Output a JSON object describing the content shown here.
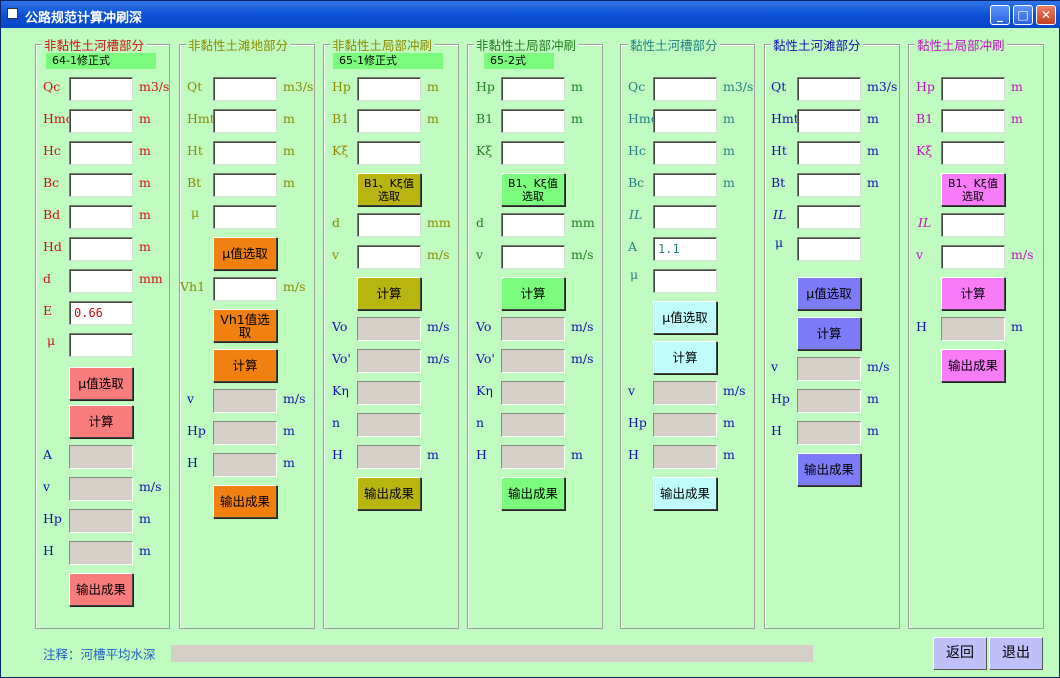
{
  "window": {
    "title": "公路规范计算冲刷深"
  },
  "titlebar_buttons": {
    "minimize": "_",
    "maximize": "□",
    "close": "✕"
  },
  "panels": {
    "p1": {
      "title": "非黏性土河槽部分",
      "tag": "64-1修正式",
      "rows": [
        {
          "label": "Qc",
          "unit": "m3/s",
          "value": ""
        },
        {
          "label": "Hmc",
          "unit": "m",
          "value": ""
        },
        {
          "label": "Hc",
          "unit": "m",
          "value": ""
        },
        {
          "label": "Bc",
          "unit": "m",
          "value": ""
        },
        {
          "label": "Bd",
          "unit": "m",
          "value": ""
        },
        {
          "label": "Hd",
          "unit": "m",
          "value": ""
        },
        {
          "label": "d",
          "unit": "mm",
          "value": ""
        },
        {
          "label": "E",
          "unit": "",
          "value": "0.66"
        },
        {
          "label": "μ",
          "unit": "",
          "value": ""
        }
      ],
      "btn_mu": "μ值选取",
      "btn_calc": "计算",
      "outputs": [
        {
          "label": "A",
          "unit": ""
        },
        {
          "label": "v",
          "unit": "m/s"
        },
        {
          "label": "Hp",
          "unit": "m"
        },
        {
          "label": "H",
          "unit": "m"
        }
      ],
      "btn_out": "输出成果"
    },
    "p2": {
      "title": "非黏性土滩地部分",
      "rows": [
        {
          "label": "Qt",
          "unit": "m3/s"
        },
        {
          "label": "Hmt",
          "unit": "m"
        },
        {
          "label": "Ht",
          "unit": "m"
        },
        {
          "label": "Bt",
          "unit": "m"
        },
        {
          "label": "μ",
          "unit": ""
        }
      ],
      "btn_mu": "μ值选取",
      "vh1_label": "Vh1",
      "vh1_unit": "m/s",
      "btn_vh1": "Vh1值选取",
      "btn_calc": "计算",
      "outputs": [
        {
          "label": "v",
          "unit": "m/s"
        },
        {
          "label": "Hp",
          "unit": "m"
        },
        {
          "label": "H",
          "unit": "m"
        }
      ],
      "btn_out": "输出成果"
    },
    "p3": {
      "title": "非黏性土局部冲刷",
      "tag": "65-1修正式",
      "rows": [
        {
          "label": "Hp",
          "unit": "m"
        },
        {
          "label": "B1",
          "unit": "m"
        },
        {
          "label": "Kξ",
          "unit": ""
        }
      ],
      "btn_b1": "B1、Kξ值选取",
      "rows2": [
        {
          "label": "d",
          "unit": "mm"
        },
        {
          "label": "v",
          "unit": "m/s"
        }
      ],
      "btn_calc": "计算",
      "outputs": [
        {
          "label": "Vo",
          "unit": "m/s"
        },
        {
          "label": "Vo'",
          "unit": "m/s"
        },
        {
          "label": "Kη",
          "unit": ""
        },
        {
          "label": "n",
          "unit": ""
        },
        {
          "label": "H",
          "unit": "m"
        }
      ],
      "btn_out": "输出成果"
    },
    "p4": {
      "title": "非黏性土局部冲刷",
      "tag": "65-2式",
      "rows": [
        {
          "label": "Hp",
          "unit": "m"
        },
        {
          "label": "B1",
          "unit": "m"
        },
        {
          "label": "Kξ",
          "unit": ""
        }
      ],
      "btn_b1": "B1、Kξ值选取",
      "rows2": [
        {
          "label": "d",
          "unit": "mm"
        },
        {
          "label": "v",
          "unit": "m/s"
        }
      ],
      "btn_calc": "计算",
      "outputs": [
        {
          "label": "Vo",
          "unit": "m/s"
        },
        {
          "label": "Vo'",
          "unit": "m/s"
        },
        {
          "label": "Kη",
          "unit": ""
        },
        {
          "label": "n",
          "unit": ""
        },
        {
          "label": "H",
          "unit": "m"
        }
      ],
      "btn_out": "输出成果"
    },
    "p5": {
      "title": "黏性土河槽部分",
      "rows": [
        {
          "label": "Qc",
          "unit": "m3/s",
          "value": ""
        },
        {
          "label": "Hmc",
          "unit": "m",
          "value": ""
        },
        {
          "label": "Hc",
          "unit": "m",
          "value": ""
        },
        {
          "label": "Bc",
          "unit": "m",
          "value": ""
        },
        {
          "label": "IL",
          "unit": "",
          "value": ""
        },
        {
          "label": "A",
          "unit": "",
          "value": "1.1"
        },
        {
          "label": "μ",
          "unit": "",
          "value": ""
        }
      ],
      "btn_mu": "μ值选取",
      "btn_calc": "计算",
      "outputs": [
        {
          "label": "v",
          "unit": "m/s"
        },
        {
          "label": "Hp",
          "unit": "m"
        },
        {
          "label": "H",
          "unit": "m"
        }
      ],
      "btn_out": "输出成果"
    },
    "p6": {
      "title": "黏性土河滩部分",
      "rows": [
        {
          "label": "Qt",
          "unit": "m3/s"
        },
        {
          "label": "Hmt",
          "unit": "m"
        },
        {
          "label": "Ht",
          "unit": "m"
        },
        {
          "label": "Bt",
          "unit": "m"
        },
        {
          "label": "IL",
          "unit": ""
        },
        {
          "label": "μ",
          "unit": ""
        }
      ],
      "btn_mu": "μ值选取",
      "btn_calc": "计算",
      "outputs": [
        {
          "label": "v",
          "unit": "m/s"
        },
        {
          "label": "Hp",
          "unit": "m"
        },
        {
          "label": "H",
          "unit": "m"
        }
      ],
      "btn_out": "输出成果"
    },
    "p7": {
      "title": "黏性土局部冲刷",
      "rows": [
        {
          "label": "Hp",
          "unit": "m"
        },
        {
          "label": "B1",
          "unit": "m"
        },
        {
          "label": "Kξ",
          "unit": ""
        }
      ],
      "btn_b1": "B1、Kξ值选取",
      "rows2": [
        {
          "label": "IL",
          "unit": ""
        },
        {
          "label": "v",
          "unit": "m/s"
        }
      ],
      "btn_calc": "计算",
      "outputs": [
        {
          "label": "H",
          "unit": "m"
        }
      ],
      "btn_out": "输出成果"
    }
  },
  "footer": {
    "note": "注释：河槽平均水深",
    "back": "返回",
    "exit": "退出"
  }
}
